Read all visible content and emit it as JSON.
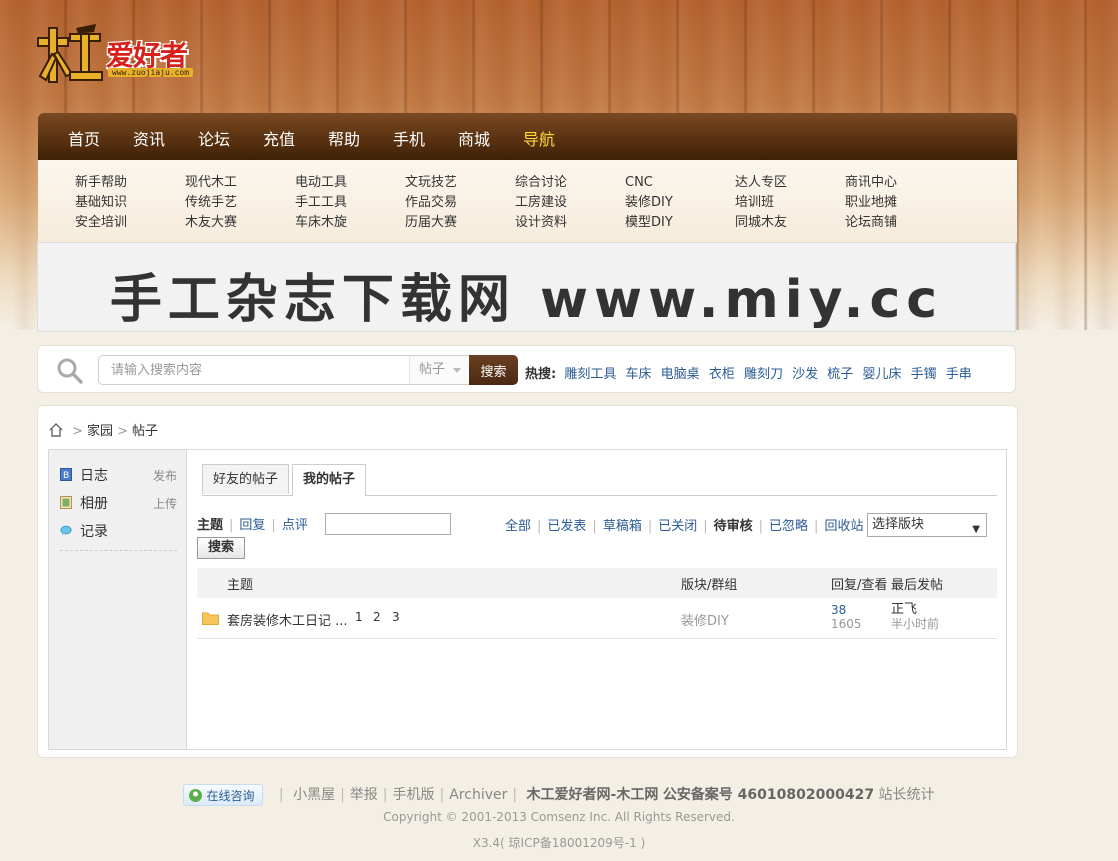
{
  "logo": {
    "text": "爱好者",
    "glyph": "木工",
    "url": "www.zuojiaju.com"
  },
  "nav": {
    "items": [
      {
        "label": "首页"
      },
      {
        "label": "资讯"
      },
      {
        "label": "论坛"
      },
      {
        "label": "充值"
      },
      {
        "label": "帮助"
      },
      {
        "label": "手机"
      },
      {
        "label": "商城"
      },
      {
        "label": "导航"
      }
    ],
    "active_color": "#ffd83a"
  },
  "subnav": {
    "columns": [
      [
        "新手帮助",
        "基础知识",
        "安全培训"
      ],
      [
        "现代木工",
        "传统手艺",
        "木友大赛"
      ],
      [
        "电动工具",
        "手工工具",
        "车床木旋"
      ],
      [
        "文玩技艺",
        "作品交易",
        "历届大赛"
      ],
      [
        "综合讨论",
        "工房建设",
        "设计资料"
      ],
      [
        "CNC",
        "装修DIY",
        "模型DIY"
      ],
      [
        "达人专区",
        "培训班",
        "同城木友"
      ],
      [
        "商讯中心",
        "职业地摊",
        "论坛商铺"
      ]
    ]
  },
  "banner": {
    "text": "手工杂志下载网 www.miy.cc"
  },
  "search": {
    "placeholder": "请输入搜索内容",
    "type": "帖子",
    "button": "搜索",
    "hot_label": "热搜:",
    "hot": [
      "雕刻工具",
      "车床",
      "电脑桌",
      "衣柜",
      "雕刻刀",
      "沙发",
      "梳子",
      "婴儿床",
      "手镯",
      "手串"
    ]
  },
  "breadcrumb": {
    "items": [
      "家园",
      "帖子"
    ]
  },
  "sidebar": {
    "items": [
      {
        "label": "日志",
        "action": "发布",
        "icon": "blog-icon"
      },
      {
        "label": "相册",
        "action": "上传",
        "icon": "album-icon"
      },
      {
        "label": "记录",
        "action": "",
        "icon": "speech-bubble-icon"
      }
    ]
  },
  "tabs": [
    {
      "label": "好友的帖子"
    },
    {
      "label": "我的帖子"
    }
  ],
  "filters": {
    "type": [
      "主题",
      "回复",
      "点评"
    ],
    "status": [
      "全部",
      "已发表",
      "草稿箱",
      "已关闭",
      "待审核",
      "已忽略",
      "回收站"
    ],
    "forum_select": "选择版块",
    "search_button": "搜索"
  },
  "table": {
    "headers": {
      "topic": "主题",
      "forum": "版块/群组",
      "stats": "回复/查看",
      "last": "最后发帖"
    },
    "rows": [
      {
        "title": "套房装修木工日记 ...",
        "pages": [
          "1",
          "2",
          "3"
        ],
        "forum": "装修DIY",
        "replies": "38",
        "views": "1605",
        "last_user": "正飞",
        "last_time": "半小时前"
      }
    ]
  },
  "footer": {
    "online": "在线咨询",
    "links": [
      "小黑屋",
      "举报",
      "手机版",
      "Archiver"
    ],
    "site": "木工爱好者网-木工网",
    "beian": "公安备案号 46010802000427",
    "stats": "站长统计",
    "copyright": "Copyright © 2001-2013 Comsenz Inc. All Rights Reserved.",
    "version": "X3.4( 琼ICP备18001209号-1 )"
  }
}
